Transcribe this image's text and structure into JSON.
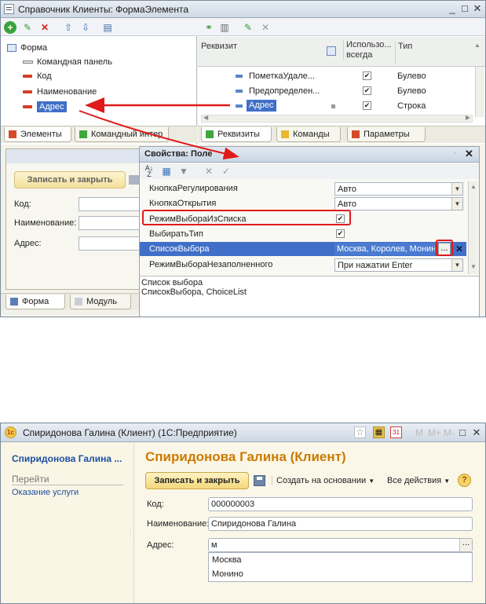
{
  "top_window": {
    "title": "Справочник Клиенты: ФормаЭлемента",
    "controls": [
      "_",
      "□",
      "✕"
    ],
    "tree": {
      "items": [
        "Форма",
        "Командная панель",
        "Код",
        "Наименование",
        "Адрес"
      ]
    },
    "left_tabs": [
      "Элементы",
      "Командный интер"
    ],
    "requisites": {
      "headers": {
        "name": "Реквизит",
        "use": "Использо... всегда",
        "type": "Тип"
      },
      "rows": [
        {
          "name": "ПометкаУдале...",
          "type": "Булево",
          "checked": "✔"
        },
        {
          "name": "Предопределен...",
          "type": "Булево",
          "checked": "✔"
        },
        {
          "name": "Адрес",
          "type": "Строка",
          "checked": "✔"
        }
      ]
    },
    "right_tabs": [
      "Реквизиты",
      "Команды",
      "Параметры"
    ],
    "preview": {
      "save_button": "Записать и закрыть",
      "labels": [
        "Код:",
        "Наименование:",
        "Адрес:"
      ],
      "bottom_tabs": [
        "Форма",
        "Модуль"
      ]
    },
    "properties": {
      "title": "Свойства: Поле",
      "rows": [
        {
          "name": "КнопкаРегулирования",
          "value": "Авто",
          "kind": "dropdown"
        },
        {
          "name": "КнопкаОткрытия",
          "value": "Авто",
          "kind": "dropdown"
        },
        {
          "name": "РежимВыбораИзСписка",
          "value": "✔",
          "kind": "checkbox"
        },
        {
          "name": "ВыбиратьТип",
          "value": "✔",
          "kind": "checkbox"
        },
        {
          "name": "СписокВыбора",
          "value": "Москва, Королев, Монин",
          "kind": "list"
        },
        {
          "name": "РежимВыбораНезаполненного",
          "value": "При нажатии Enter",
          "kind": "dropdown"
        }
      ],
      "desc_line1": "Список выбора",
      "desc_line2": "СписокВыбора, ChoiceList",
      "ellipsis": "..."
    }
  },
  "bottom_window": {
    "title": "Спиридонова Галина (Клиент) (1С:Предприятие)",
    "toolbar_letters": [
      "M",
      "M+",
      "M-"
    ],
    "sidebar": {
      "title": "Спиридонова Галина ...",
      "section": "Перейти",
      "link": "Оказание услуги"
    },
    "header": "Спиридонова Галина (Клиент)",
    "save_button": "Записать и закрыть",
    "create_based": "Создать на основании",
    "all_actions": "Все действия",
    "help": "?",
    "fields": {
      "code_label": "Код:",
      "code_value": "000000003",
      "name_label": "Наименование:",
      "name_value": "Спиридонова Галина",
      "address_label": "Адрес:",
      "address_value": "м"
    },
    "dropdown_options": [
      "Москва",
      "Монино"
    ],
    "ellipsis": "..."
  },
  "colors": {
    "accent_red": "#e01a1a",
    "selection_blue": "#4a76c8",
    "header_orange": "#cc7a00",
    "link_blue": "#1c4fa0"
  }
}
